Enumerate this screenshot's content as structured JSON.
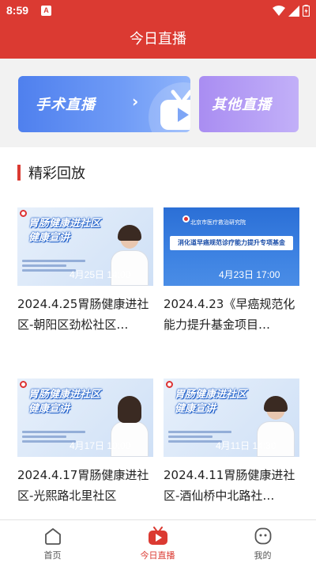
{
  "status_bar": {
    "time": "8:59",
    "notification_badge": "A"
  },
  "header": {
    "title": "今日直播"
  },
  "banners": {
    "surgery": {
      "label": "手术直播",
      "chevron": "›"
    },
    "other": {
      "label": "其他直播"
    }
  },
  "section": {
    "title": "精彩回放"
  },
  "cards": [
    {
      "headline_1": "胃肠健康进社区",
      "headline_2": "健康宣讲",
      "stamp": "4月25日 14:00",
      "caption": "2024.4.25胃肠健康进社区-朝阳区劲松社区…"
    },
    {
      "top_line": "北京市医疗救治研究院",
      "title_box": "消化道早癌规范诊疗能力提升专项基金",
      "stamp": "4月23日 17:00",
      "caption": "2024.4.23《早癌规范化能力提升基金项目…"
    },
    {
      "headline_1": "胃肠健康进社区",
      "headline_2": "健康宣讲",
      "stamp": "4月17日 10:00",
      "caption": "2024.4.17胃肠健康进社区-光熙路北里社区"
    },
    {
      "headline_1": "胃肠健康进社区",
      "headline_2": "健康宣讲",
      "stamp": "4月11日 14:30",
      "caption": "2024.4.11胃肠健康进社区-酒仙桥中北路社…"
    }
  ],
  "tabs": [
    {
      "label": "首页"
    },
    {
      "label": "今日直播",
      "active": true
    },
    {
      "label": "我的"
    }
  ],
  "colors": {
    "brand_red": "#db3a32",
    "surgery_blue": "#4f80ee",
    "other_purple": "#a98df2"
  }
}
